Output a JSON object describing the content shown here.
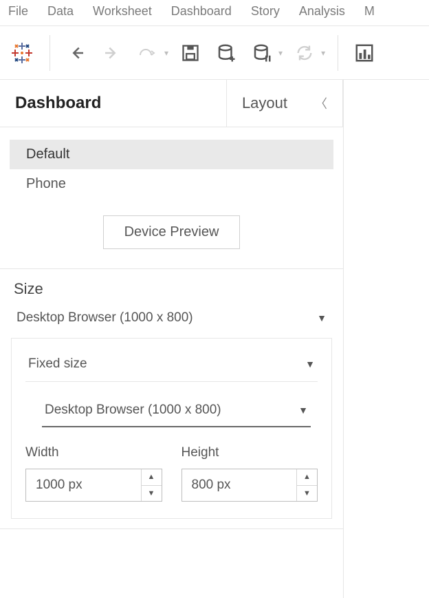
{
  "menu": {
    "items": [
      "File",
      "Data",
      "Worksheet",
      "Dashboard",
      "Story",
      "Analysis",
      "M"
    ]
  },
  "panel": {
    "tabs": {
      "dashboard": "Dashboard",
      "layout": "Layout"
    },
    "devices": {
      "default": "Default",
      "phone": "Phone",
      "preview_button": "Device Preview"
    },
    "size": {
      "title": "Size",
      "summary": "Desktop Browser (1000 x 800)",
      "mode": "Fixed size",
      "preset": "Desktop Browser (1000 x 800)",
      "width_label": "Width",
      "height_label": "Height",
      "width_value": "1000 px",
      "height_value": "800 px"
    }
  }
}
